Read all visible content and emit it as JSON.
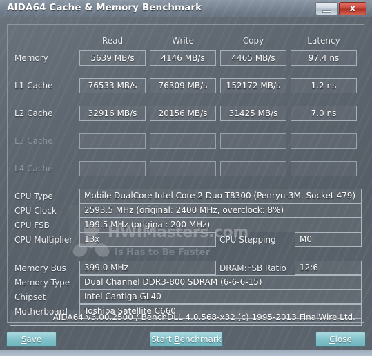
{
  "window": {
    "title": "AIDA64 Cache & Memory Benchmark",
    "minimize_label": "",
    "close_label": "x"
  },
  "watermark": {
    "text": "HWIMasters.com",
    "tagline": "Is Has to Be Faster"
  },
  "benchmark": {
    "columns": [
      "Read",
      "Write",
      "Copy",
      "Latency"
    ],
    "rows": [
      {
        "label": "Memory",
        "disabled": false,
        "values": [
          "5639 MB/s",
          "4146 MB/s",
          "4465 MB/s",
          "97.4 ns"
        ]
      },
      {
        "label": "L1 Cache",
        "disabled": false,
        "values": [
          "76533 MB/s",
          "76309 MB/s",
          "152172 MB/s",
          "1.2 ns"
        ]
      },
      {
        "label": "L2 Cache",
        "disabled": false,
        "values": [
          "32916 MB/s",
          "20156 MB/s",
          "31425 MB/s",
          "7.0 ns"
        ]
      },
      {
        "label": "L3 Cache",
        "disabled": true,
        "values": [
          "",
          "",
          "",
          ""
        ]
      },
      {
        "label": "L4 Cache",
        "disabled": true,
        "values": [
          "",
          "",
          "",
          ""
        ]
      }
    ]
  },
  "system_info": {
    "cpu_type_label": "CPU Type",
    "cpu_type_value": "Mobile DualCore Intel Core 2 Duo T8300  (Penryn-3M, Socket 479)",
    "cpu_clock_label": "CPU Clock",
    "cpu_clock_value": "2593.5 MHz  (original: 2400 MHz, overclock: 8%)",
    "cpu_fsb_label": "CPU FSB",
    "cpu_fsb_value": "199.5 MHz  (original: 200 MHz)",
    "cpu_multiplier_label": "CPU Multiplier",
    "cpu_multiplier_value": "13x",
    "cpu_stepping_label": "CPU Stepping",
    "cpu_stepping_value": "M0",
    "memory_bus_label": "Memory Bus",
    "memory_bus_value": "399.0 MHz",
    "dram_fsb_ratio_label": "DRAM:FSB Ratio",
    "dram_fsb_ratio_value": "12:6",
    "memory_type_label": "Memory Type",
    "memory_type_value": "Dual Channel DDR3-800 SDRAM  (6-6-6-15)",
    "chipset_label": "Chipset",
    "chipset_value": "Intel Cantiga GL40",
    "motherboard_label": "Motherboard",
    "motherboard_value": "Toshiba Satellite C660"
  },
  "footer": {
    "version_text": "AIDA64 v3.00.2500 / BenchDLL 4.0.568-x32  (c) 1995-2013 FinalWire Ltd."
  },
  "buttons": {
    "save": {
      "pre": "",
      "accel": "S",
      "post": "ave"
    },
    "start_benchmark": {
      "pre": "Start ",
      "accel": "B",
      "post": "enchmark"
    },
    "close": {
      "pre": "",
      "accel": "C",
      "post": "lose"
    }
  },
  "colors": {
    "window_chrome": "#7c8895",
    "panel_bg": "#5e666f",
    "button_accent": "#82c2ca",
    "close_red": "#c9483c",
    "text_primary": "#ffffff",
    "text_disabled": "#8e969f",
    "field_border": "#aeb6bf"
  }
}
